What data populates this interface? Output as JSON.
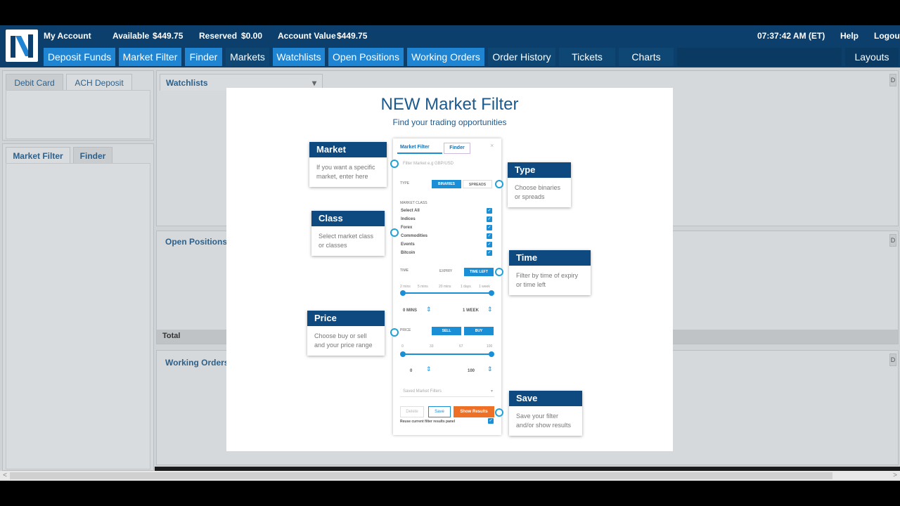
{
  "topbar": {
    "my_account": "My Account",
    "available_label": "Available",
    "available_value": "$449.75",
    "reserved_label": "Reserved",
    "reserved_value": "$0.00",
    "account_value_label": "Account Value",
    "account_value": "$449.75",
    "clock": "07:37:42 AM (ET)",
    "help": "Help",
    "logout": "Logout"
  },
  "nav": {
    "deposit_funds": "Deposit Funds",
    "market_filter": "Market Filter",
    "finder": "Finder",
    "markets": "Markets",
    "watchlists": "Watchlists",
    "open_positions": "Open Positions",
    "working_orders": "Working Orders",
    "order_history": "Order History",
    "tickets": "Tickets",
    "charts": "Charts",
    "layouts": "Layouts"
  },
  "left": {
    "debit_card": "Debit Card",
    "ach_deposit": "ACH Deposit",
    "market_filter": "Market Filter",
    "finder": "Finder"
  },
  "center": {
    "watchlists": "Watchlists",
    "open_positions": "Open Positions",
    "total": "Total",
    "working_orders": "Working Orders",
    "panel_button": "D"
  },
  "modal": {
    "title": "NEW Market Filter",
    "subtitle": "Find your trading opportunities",
    "callouts": {
      "market": {
        "title": "Market",
        "body": "If you want a specific market, enter here"
      },
      "type": {
        "title": "Type",
        "body": "Choose binaries or spreads"
      },
      "class": {
        "title": "Class",
        "body": "Select market class or classes"
      },
      "time": {
        "title": "Time",
        "body": "Filter by time of expiry or time left"
      },
      "price": {
        "title": "Price",
        "body": "Choose buy or sell and your price range"
      },
      "save": {
        "title": "Save",
        "body": "Save your filter and/or show results"
      }
    },
    "phone": {
      "tab_market_filter": "Market Filter",
      "tab_finder": "Finder",
      "close": "×",
      "filter_placeholder": "Filter Market e.g GBP/USD",
      "type_label": "TYPE",
      "binaries": "BINARIES",
      "spreads": "SPREADS",
      "market_class_label": "MARKET CLASS",
      "classes": [
        "Select All",
        "Indices",
        "Forex",
        "Commodities",
        "Events",
        "Bitcoin"
      ],
      "check": "✓",
      "time_label": "TIME",
      "expiry": "EXPIRY",
      "time_left": "TIME LEFT",
      "time_ticks": [
        "2 mins",
        "5 mins",
        "20 mins",
        "1 days",
        "1 week"
      ],
      "time_min": "0 MINS",
      "time_max": "1 WEEK",
      "price_label": "PRICE",
      "sell": "SELL",
      "buy": "BUY",
      "price_ticks": [
        "0",
        "33",
        "67",
        "100"
      ],
      "price_min": "0",
      "price_max": "100",
      "saved_filters": "Saved Market Filters",
      "delete": "Delete",
      "save": "Save",
      "show_results": "Show Results",
      "reuse_panel": "Reuse current filter results panel",
      "spinner": "⇕",
      "dropdown_caret": "▾"
    }
  },
  "scroll": {
    "left": "<",
    "right": ">"
  },
  "watchlist_caret": "▾"
}
